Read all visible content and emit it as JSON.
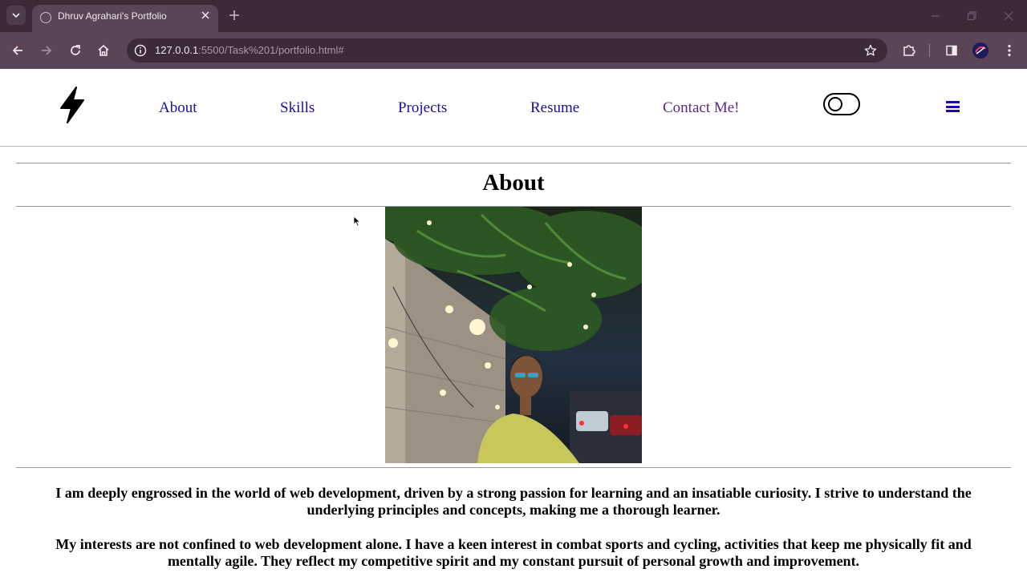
{
  "browser": {
    "tab_title": "Dhruv Agrahari's Portfolio",
    "url_host": "127.0.0.1",
    "url_rest": ":5500/Task%201/portfolio.html#"
  },
  "nav": {
    "links": [
      "About",
      "Skills",
      "Projects",
      "Resume",
      "Contact Me!"
    ]
  },
  "about": {
    "title": "About",
    "paragraph_1": "I am deeply engrossed in the world of web development, driven by a strong passion for learning and an insatiable curiosity. I strive to understand the underlying principles and concepts, making me a thorough learner.",
    "paragraph_2": "My interests are not confined to web development alone. I have a keen interest in combat sports and cycling, activities that keep me physically fit and mentally agile. They reflect my competitive spirit and my constant pursuit of personal growth and improvement."
  },
  "colors": {
    "tabbar": "#3c2a3b",
    "toolbar": "#5a4558",
    "link": "#1a0dab",
    "visited_link": "#5b2a86"
  },
  "icons": [
    "tab-search-icon",
    "globe-icon",
    "close-icon",
    "plus-icon",
    "back-icon",
    "forward-icon",
    "reload-icon",
    "home-icon",
    "info-icon",
    "star-icon",
    "extensions-icon",
    "sidepanel-icon",
    "menu-dots-icon",
    "bolt-icon",
    "toggle-icon",
    "hamburger-icon"
  ]
}
